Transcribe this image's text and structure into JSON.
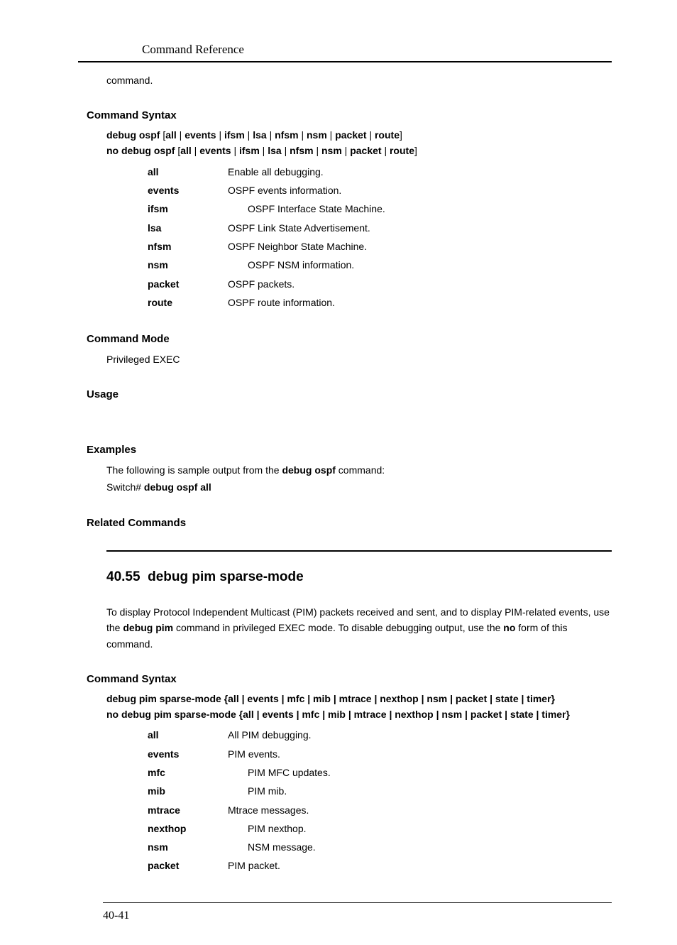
{
  "header": {
    "running_title": "Command Reference"
  },
  "first_block": {
    "tail_text": "command.",
    "headings": {
      "syntax": "Command Syntax",
      "mode": "Command Mode",
      "usage": "Usage",
      "examples": "Examples",
      "related": "Related Commands"
    },
    "syntax_lines": [
      {
        "parts": [
          "debug ospf",
          " [",
          "all",
          " | ",
          "events",
          " | ",
          "ifsm",
          " | ",
          "lsa",
          " | ",
          "nfsm",
          " | ",
          "nsm",
          " | ",
          "packet",
          " | ",
          "route",
          "]"
        ]
      },
      {
        "parts": [
          "no debug ospf",
          " [",
          "all",
          " | ",
          "events",
          " | ",
          "ifsm",
          " | ",
          "lsa",
          " | ",
          "nfsm",
          " | ",
          "nsm",
          " | ",
          "packet",
          " | ",
          "route",
          "]"
        ]
      }
    ],
    "params": [
      {
        "key": "all",
        "desc": "Enable all debugging.",
        "indent": false
      },
      {
        "key": "events",
        "desc": "OSPF events information.",
        "indent": false
      },
      {
        "key": "ifsm",
        "desc": "OSPF Interface State Machine.",
        "indent": true
      },
      {
        "key": "lsa",
        "desc": "OSPF Link State Advertisement.",
        "indent": false
      },
      {
        "key": "nfsm",
        "desc": "OSPF Neighbor State Machine.",
        "indent": false
      },
      {
        "key": "nsm",
        "desc": "OSPF NSM information.",
        "indent": true
      },
      {
        "key": "packet",
        "desc": "OSPF packets.",
        "indent": false
      },
      {
        "key": "route",
        "desc": "OSPF route information.",
        "indent": false
      }
    ],
    "mode_text": "Privileged EXEC",
    "examples": {
      "pre_text": "The following is sample output from the ",
      "bold": "debug ospf",
      "post_text": " command:",
      "line2_prompt": "Switch# ",
      "line2_cmd": "debug ospf all"
    }
  },
  "second_block": {
    "section_number": "40.55",
    "section_title": "debug pim sparse-mode",
    "intro_pre": "To display Protocol Independent Multicast (PIM) packets received and sent, and to display PIM-related events, use the ",
    "intro_bold1": "debug pim",
    "intro_mid": " command in privileged EXEC mode. To disable debugging output, use the ",
    "intro_bold2": "no",
    "intro_post": " form of this command.",
    "headings": {
      "syntax": "Command Syntax"
    },
    "syntax_lines": [
      "debug pim sparse-mode {all | events | mfc | mib | mtrace | nexthop | nsm | packet | state | timer}",
      "no debug pim sparse-mode {all | events | mfc | mib | mtrace | nexthop | nsm | packet | state | timer}"
    ],
    "params": [
      {
        "key": "all",
        "desc": "All PIM debugging.",
        "indent": false
      },
      {
        "key": "events",
        "desc": "PIM events.",
        "indent": false
      },
      {
        "key": "mfc",
        "desc": "PIM MFC updates.",
        "indent": true
      },
      {
        "key": "mib",
        "desc": "PIM mib.",
        "indent": true
      },
      {
        "key": "mtrace",
        "desc": "Mtrace messages.",
        "indent": false
      },
      {
        "key": "nexthop",
        "desc": "PIM nexthop.",
        "indent": true
      },
      {
        "key": "nsm",
        "desc": "NSM message.",
        "indent": true
      },
      {
        "key": "packet",
        "desc": "PIM packet.",
        "indent": false
      }
    ]
  },
  "footer": {
    "page_number": "40-41"
  }
}
